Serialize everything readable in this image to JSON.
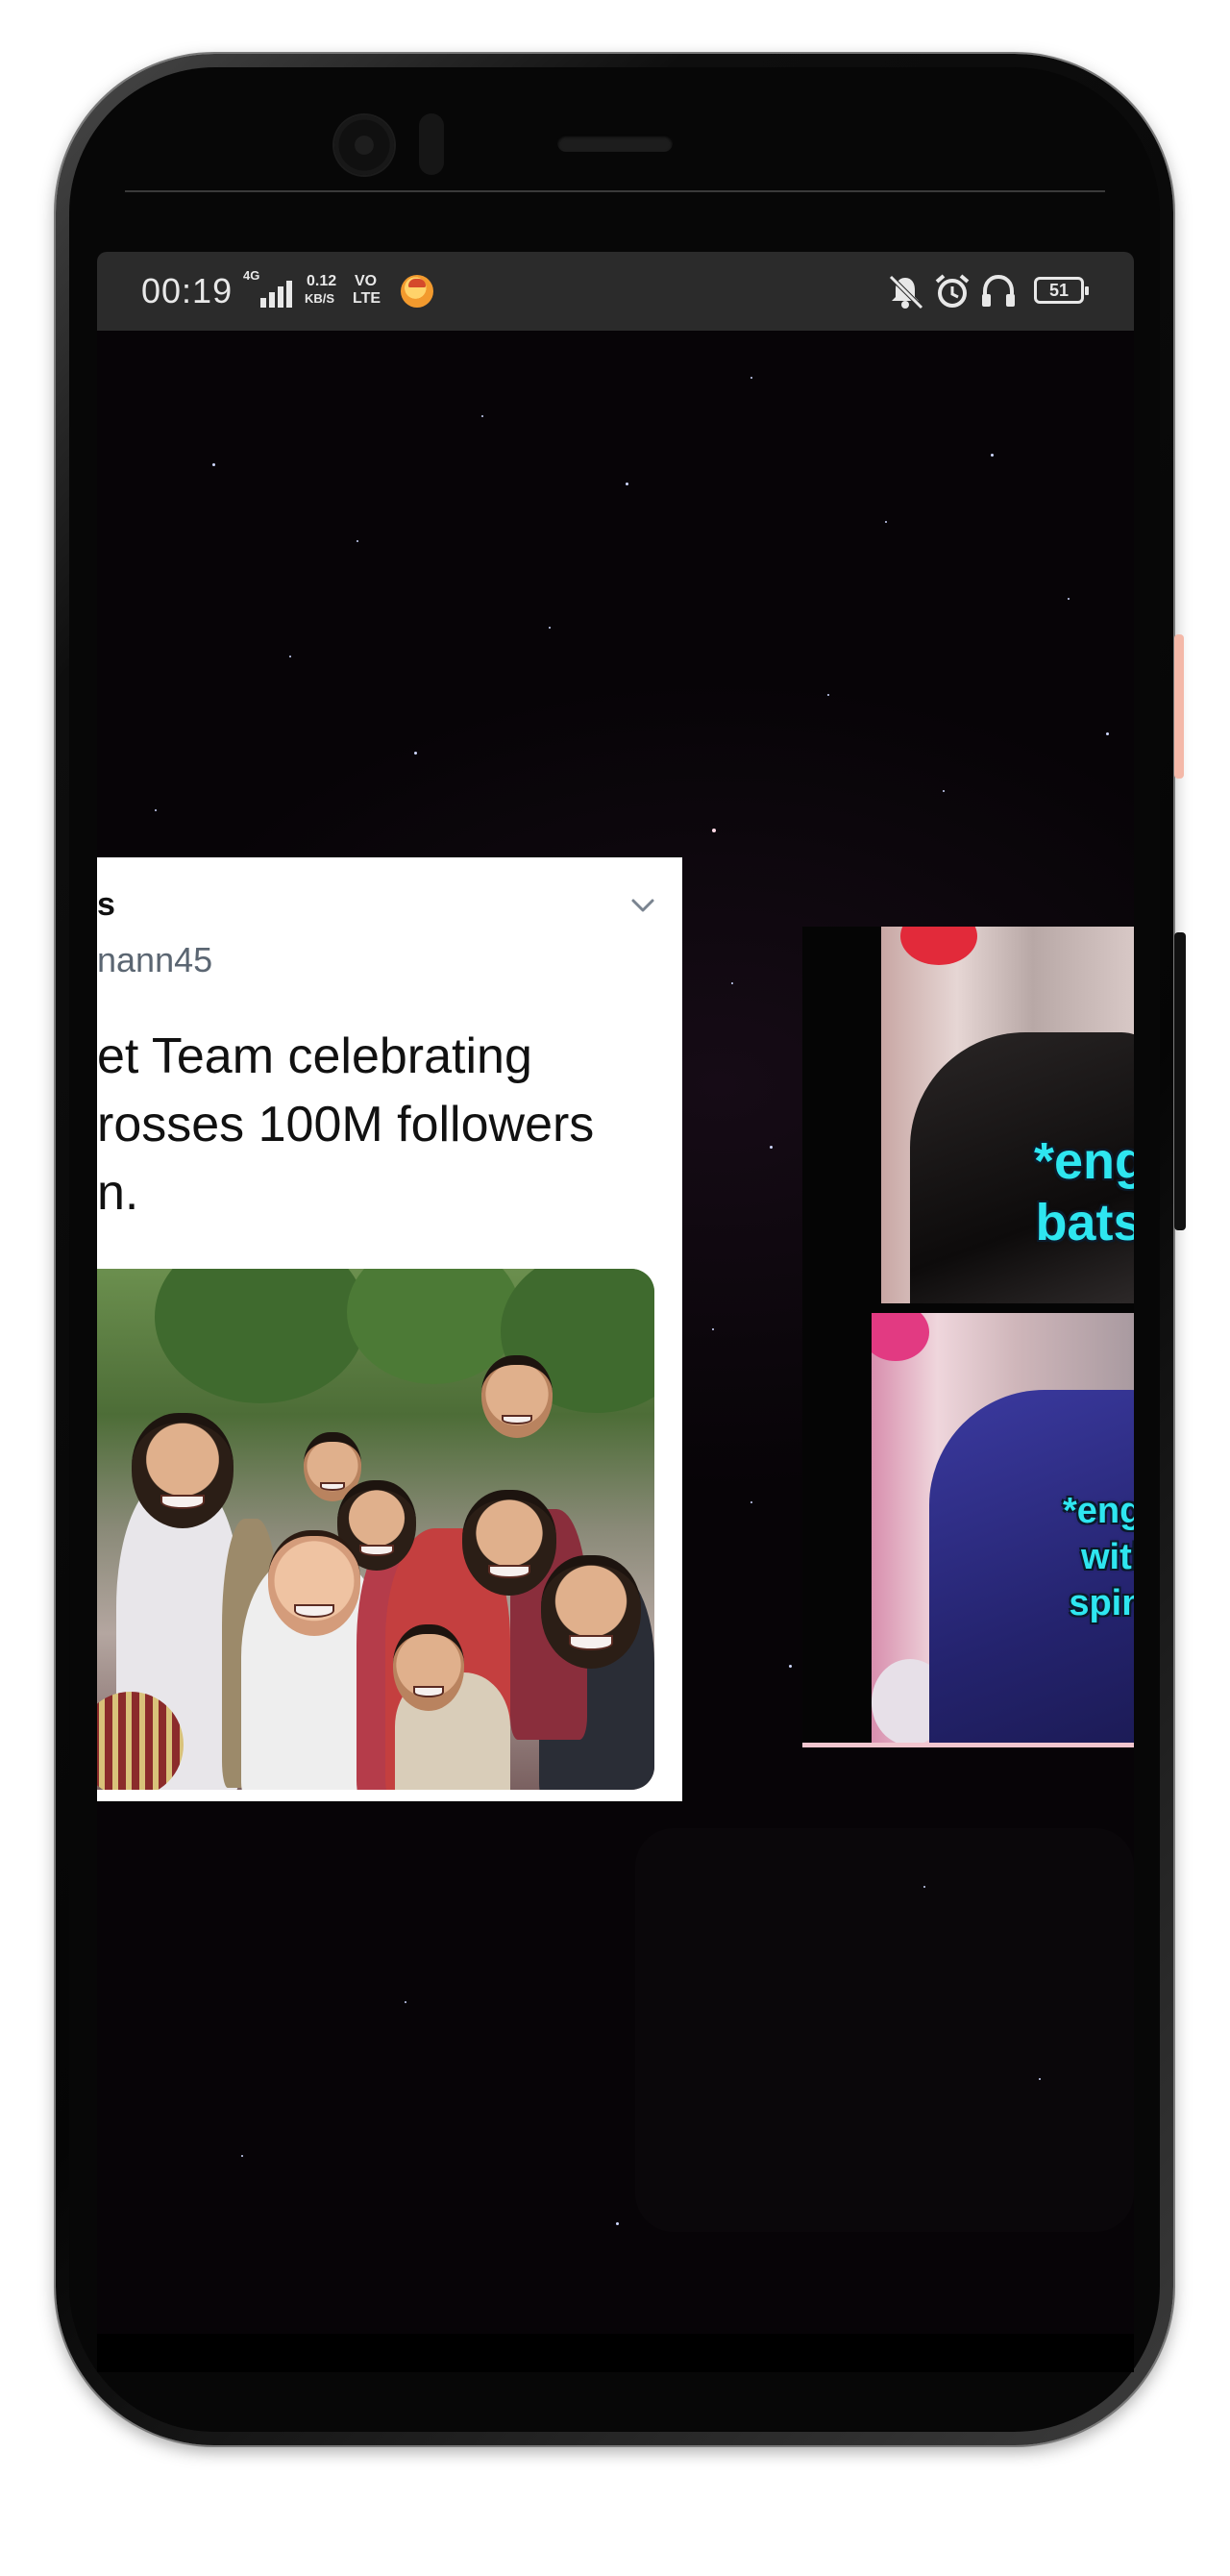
{
  "status_bar": {
    "time": "00:19",
    "network_type": "4G",
    "speed_value": "0.12",
    "speed_unit": "KB/S",
    "volte_line1": "VO",
    "volte_line2": "LTE",
    "battery_level": "51",
    "icons": [
      "signal-icon",
      "emoji-notification-icon",
      "mute-icon",
      "alarm-icon",
      "headphones-icon",
      "battery-icon"
    ]
  },
  "tweet": {
    "name_fragment": "s",
    "handle_fragment": "nann45",
    "text_lines": [
      "et Team celebrating",
      "rosses 100M followers",
      "n."
    ],
    "image_alt": "group celebration photo"
  },
  "video_preview": {
    "caption_top_line1": "*engla",
    "caption_top_line2": "batsm",
    "caption_bottom_line1": "*engla",
    "caption_bottom_line2": "with",
    "caption_bottom_line3": "spinn",
    "caption_color": "#2ee6f0"
  },
  "colors": {
    "background": "#070407",
    "status_bar": "#2b2b2b",
    "card": "#ffffff",
    "handle": "#5b6672"
  }
}
